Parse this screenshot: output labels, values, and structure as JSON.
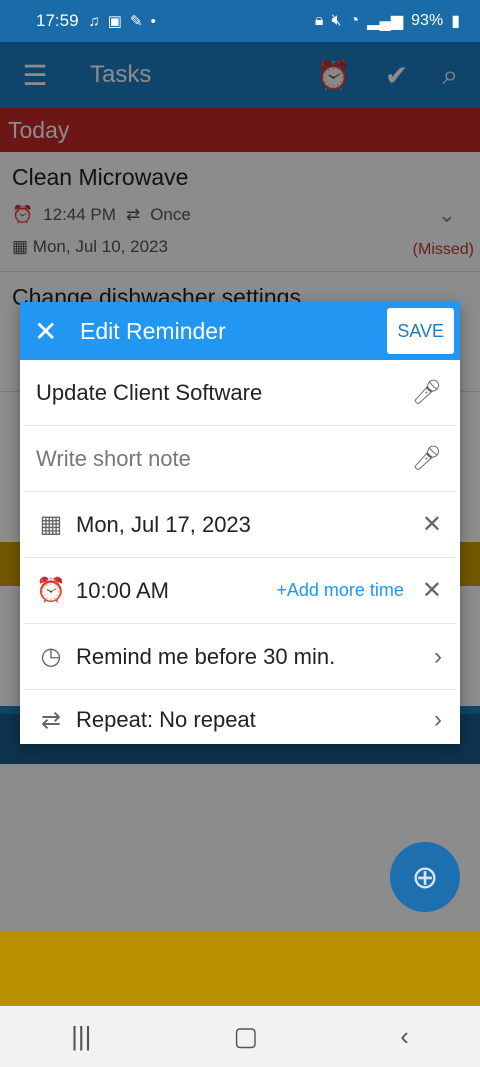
{
  "status_bar": {
    "time": "17:59",
    "battery": "93%"
  },
  "app_bar": {
    "title": "Tasks"
  },
  "sections": {
    "today": "Today",
    "today_color": "#c62828"
  },
  "tasks": [
    {
      "title": "Clean Microwave",
      "time": "12:44 PM",
      "repeat": "Once",
      "date": "Mon, Jul 10, 2023",
      "status": "(Missed)"
    },
    {
      "title": "Change dishwasher settings"
    }
  ],
  "dialog": {
    "title": "Edit Reminder",
    "save_label": "SAVE",
    "task_name": "Update Client Software",
    "note_placeholder": "Write short note",
    "date": "Mon, Jul 17, 2023",
    "time": "10:00 AM",
    "add_more_time": "+Add more time",
    "remind_before": "Remind me before 30 min.",
    "repeat": "Repeat: No repeat"
  },
  "colors": {
    "app_bar": "#1d7cc4",
    "dialog_header": "#2196f3",
    "missed": "#c0392b"
  }
}
